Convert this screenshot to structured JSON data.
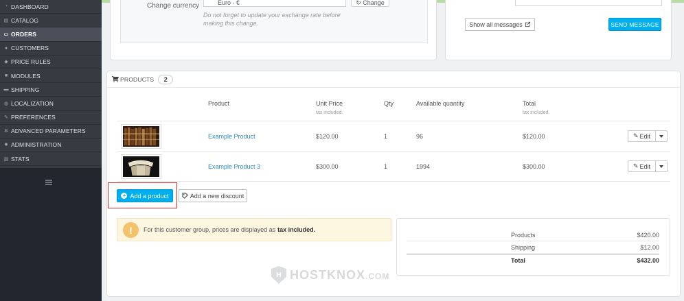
{
  "sidebar": {
    "items": [
      {
        "label": "DASHBOARD",
        "icon": "dashboard-icon",
        "active": false
      },
      {
        "label": "CATALOG",
        "icon": "catalog-icon",
        "active": false
      },
      {
        "label": "ORDERS",
        "icon": "credit-card-icon",
        "active": true
      },
      {
        "label": "CUSTOMERS",
        "icon": "users-icon",
        "active": false
      },
      {
        "label": "PRICE RULES",
        "icon": "tag-icon",
        "active": false
      },
      {
        "label": "MODULES",
        "icon": "puzzle-icon",
        "active": false
      },
      {
        "label": "SHIPPING",
        "icon": "truck-icon",
        "active": false
      },
      {
        "label": "LOCALIZATION",
        "icon": "globe-icon",
        "active": false
      },
      {
        "label": "PREFERENCES",
        "icon": "wrench-icon",
        "active": false
      },
      {
        "label": "ADVANCED PARAMETERS",
        "icon": "cogs-icon",
        "active": false
      },
      {
        "label": "ADMINISTRATION",
        "icon": "gear-icon",
        "active": false
      },
      {
        "label": "STATS",
        "icon": "bar-chart-icon",
        "active": false
      }
    ]
  },
  "currency": {
    "label": "Change currency",
    "selected": "Euro - €",
    "change_btn": "Change",
    "note": "Do not forget to update your exchange rate before making this change."
  },
  "messages": {
    "show_all": "Show all messages",
    "send": "SEND MESSAGE"
  },
  "products": {
    "heading": "PRODUCTS",
    "count": "2",
    "columns": {
      "product": "Product",
      "unit_price": "Unit Price",
      "unit_price_sub": "tax included.",
      "qty": "Qty",
      "available": "Available quantity",
      "total": "Total",
      "total_sub": "tax included."
    },
    "rows": [
      {
        "name": "Example Product",
        "price": "$120.00",
        "qty": "1",
        "available": "96",
        "total": "$120.00",
        "edit": "Edit"
      },
      {
        "name": "Example Product 3",
        "price": "$300.00",
        "qty": "1",
        "available": "1994",
        "total": "$300.00",
        "edit": "Edit"
      }
    ],
    "add_product": "Add a product",
    "add_discount": "Add a new discount"
  },
  "alert": {
    "text": "For this customer group, prices are displayed as",
    "bold": "tax included."
  },
  "totals": {
    "products_label": "Products",
    "products_value": "$420.00",
    "shipping_label": "Shipping",
    "shipping_value": "$12.00",
    "total_label": "Total",
    "total_value": "$432.00"
  },
  "watermark": {
    "text": "HOSTKNOX",
    "suffix": ".COM"
  }
}
